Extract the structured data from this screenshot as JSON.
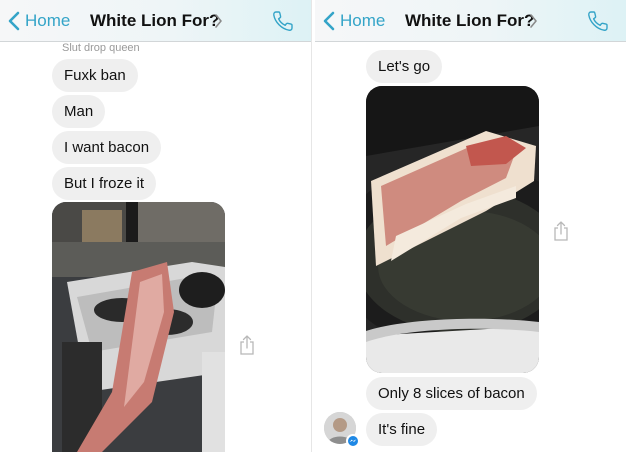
{
  "conversation": {
    "back_label": "Home",
    "title": "White Lion For?",
    "accent_color": "#34a4c8"
  },
  "left": {
    "sender_name": "Slut drop queen",
    "messages": [
      "Fuxk ban",
      "Man",
      "I want bacon",
      "But I froze it"
    ],
    "photo": {
      "icon": "photo-frozen-bacon-in-kitchen"
    },
    "share_icon": "share-icon"
  },
  "right": {
    "messages_top": [
      "Let's go"
    ],
    "photo": {
      "icon": "photo-bacon-in-frying-pan"
    },
    "messages_bottom": [
      "Only 8 slices of bacon",
      "It's fine"
    ],
    "share_icon": "share-icon",
    "avatar_icon": "avatar",
    "badge_icon": "messenger-icon"
  }
}
